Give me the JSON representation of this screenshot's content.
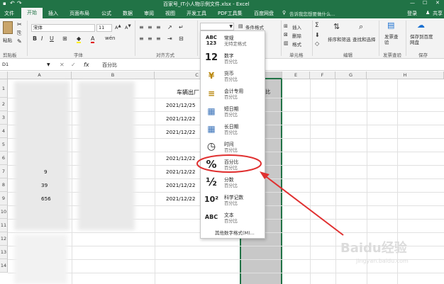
{
  "title": "百家号_IT小人物示例文件.xlsx - Excel",
  "tabs": [
    "文件",
    "开始",
    "插入",
    "页面布局",
    "公式",
    "数据",
    "审阅",
    "视图",
    "开发工具",
    "PDF工具集",
    "百度网盘"
  ],
  "search_placeholder": "告诉我您想要做什么...",
  "user": "登录",
  "share": "共享",
  "ribbon": {
    "paste": "粘贴",
    "clipboard": "剪贴板",
    "font_name": "宋体",
    "font_size": "11",
    "font_group": "字体",
    "align_group": "对齐方式",
    "cond_format": "条件格式",
    "insert": "插入",
    "delete": "删除",
    "format": "格式",
    "cells_group": "单元格",
    "sort_filter": "排序和筛选",
    "find_select": "查找和选择",
    "edit_group": "编辑",
    "invoice": "发票查验",
    "invoice_group": "发票查验",
    "save_to": "保存到百度网盘",
    "save_group": "保存"
  },
  "formula": {
    "name_box": "D1",
    "content": "百分比"
  },
  "columns": [
    "A",
    "B",
    "C",
    "D",
    "E",
    "F",
    "G",
    "H"
  ],
  "rows": [
    "1",
    "2",
    "3",
    "4",
    "5",
    "6",
    "7",
    "8",
    "9",
    "10",
    "11",
    "12",
    "13",
    "14"
  ],
  "cells": {
    "c1": "车辆出厂",
    "d1": "比",
    "dates": [
      "2021/12/25",
      "2021/12/22",
      "2021/12/22",
      "2021/12/22",
      "2021/12/22",
      "2021/12/22",
      "2021/12/22"
    ],
    "a_frag": [
      "9",
      "39",
      "656"
    ]
  },
  "format_menu": [
    {
      "icon": "ABC\n123",
      "name": "常规",
      "sample": "无特定格式"
    },
    {
      "icon": "12",
      "name": "数字",
      "sample": "百分比"
    },
    {
      "icon": "¥",
      "name": "货币",
      "sample": "百分比"
    },
    {
      "icon": "≡",
      "name": "会计专用",
      "sample": "百分比"
    },
    {
      "icon": "▦",
      "name": "短日期",
      "sample": "百分比"
    },
    {
      "icon": "▦",
      "name": "长日期",
      "sample": "百分比"
    },
    {
      "icon": "◷",
      "name": "时间",
      "sample": "百分比"
    },
    {
      "icon": "%",
      "name": "百分比",
      "sample": "百分比"
    },
    {
      "icon": "½",
      "name": "分数",
      "sample": "百分比"
    },
    {
      "icon": "10²",
      "name": "科学记数",
      "sample": "百分比"
    },
    {
      "icon": "ABC",
      "name": "文本",
      "sample": "百分比"
    }
  ],
  "more_formats": "其他数字格式(M)...",
  "watermark": "Baidu经验",
  "watermark_url": "jingyan.baidu.com",
  "colors": {
    "excel_green": "#217346",
    "annotation_red": "#e03030",
    "selection_gray": "#c8c8c8"
  }
}
